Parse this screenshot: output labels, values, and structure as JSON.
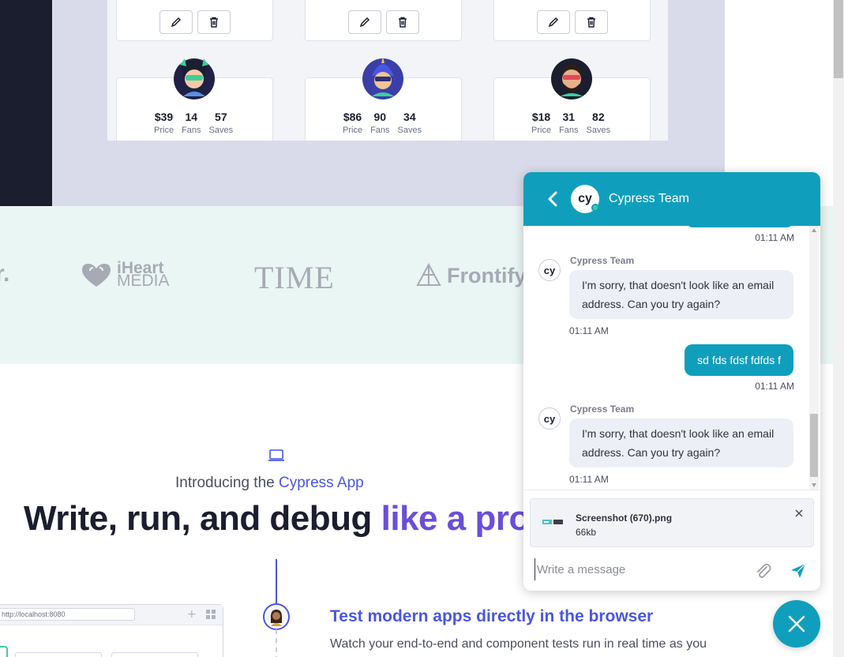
{
  "preview": {
    "cards": [
      {
        "price": "$39",
        "fans": "14",
        "saves": "57"
      },
      {
        "price": "$86",
        "fans": "90",
        "saves": "34"
      },
      {
        "price": "$18",
        "fans": "31",
        "saves": "82"
      }
    ],
    "labels": {
      "price": "Price",
      "fans": "Fans",
      "saves": "Saves"
    }
  },
  "logos": {
    "partial": "r.",
    "iheart_top": "iHeart",
    "iheart_bottom": "MEDIA",
    "time": "TIME",
    "frontify": "Frontify"
  },
  "intro": {
    "prefix": "Introducing the ",
    "accent": "Cypress App",
    "headline_main": "Write, run, and debug ",
    "headline_accent": "like a pro"
  },
  "feature": {
    "title": "Test modern apps directly in the browser",
    "description": "Watch your end-to-end and component tests run in real time as you"
  },
  "mini_browser": {
    "url": "http://localhost:8080"
  },
  "chat": {
    "title": "Cypress Team",
    "logo_text": "cy",
    "messages": {
      "t0": "01:11 AM",
      "agent_name": "Cypress Team",
      "agent_msg_1": "I'm sorry, that doesn't look like an email address. Can you try again?",
      "t1": "01:11 AM",
      "user_msg": "sd fds fdsf fdfds f",
      "t2": "01:11 AM",
      "agent_msg_2": "I'm sorry, that doesn't look like an email address. Can you try again?",
      "t3": "01:11 AM"
    },
    "attachment": {
      "name": "Screenshot (670).png",
      "size": "66kb"
    },
    "input_placeholder": "Write a message"
  },
  "colors": {
    "chat_accent": "#0f9fbc",
    "brand_blue": "#4956e3",
    "brand_purple": "#6b4ed8",
    "dark": "#1b1e2e"
  }
}
